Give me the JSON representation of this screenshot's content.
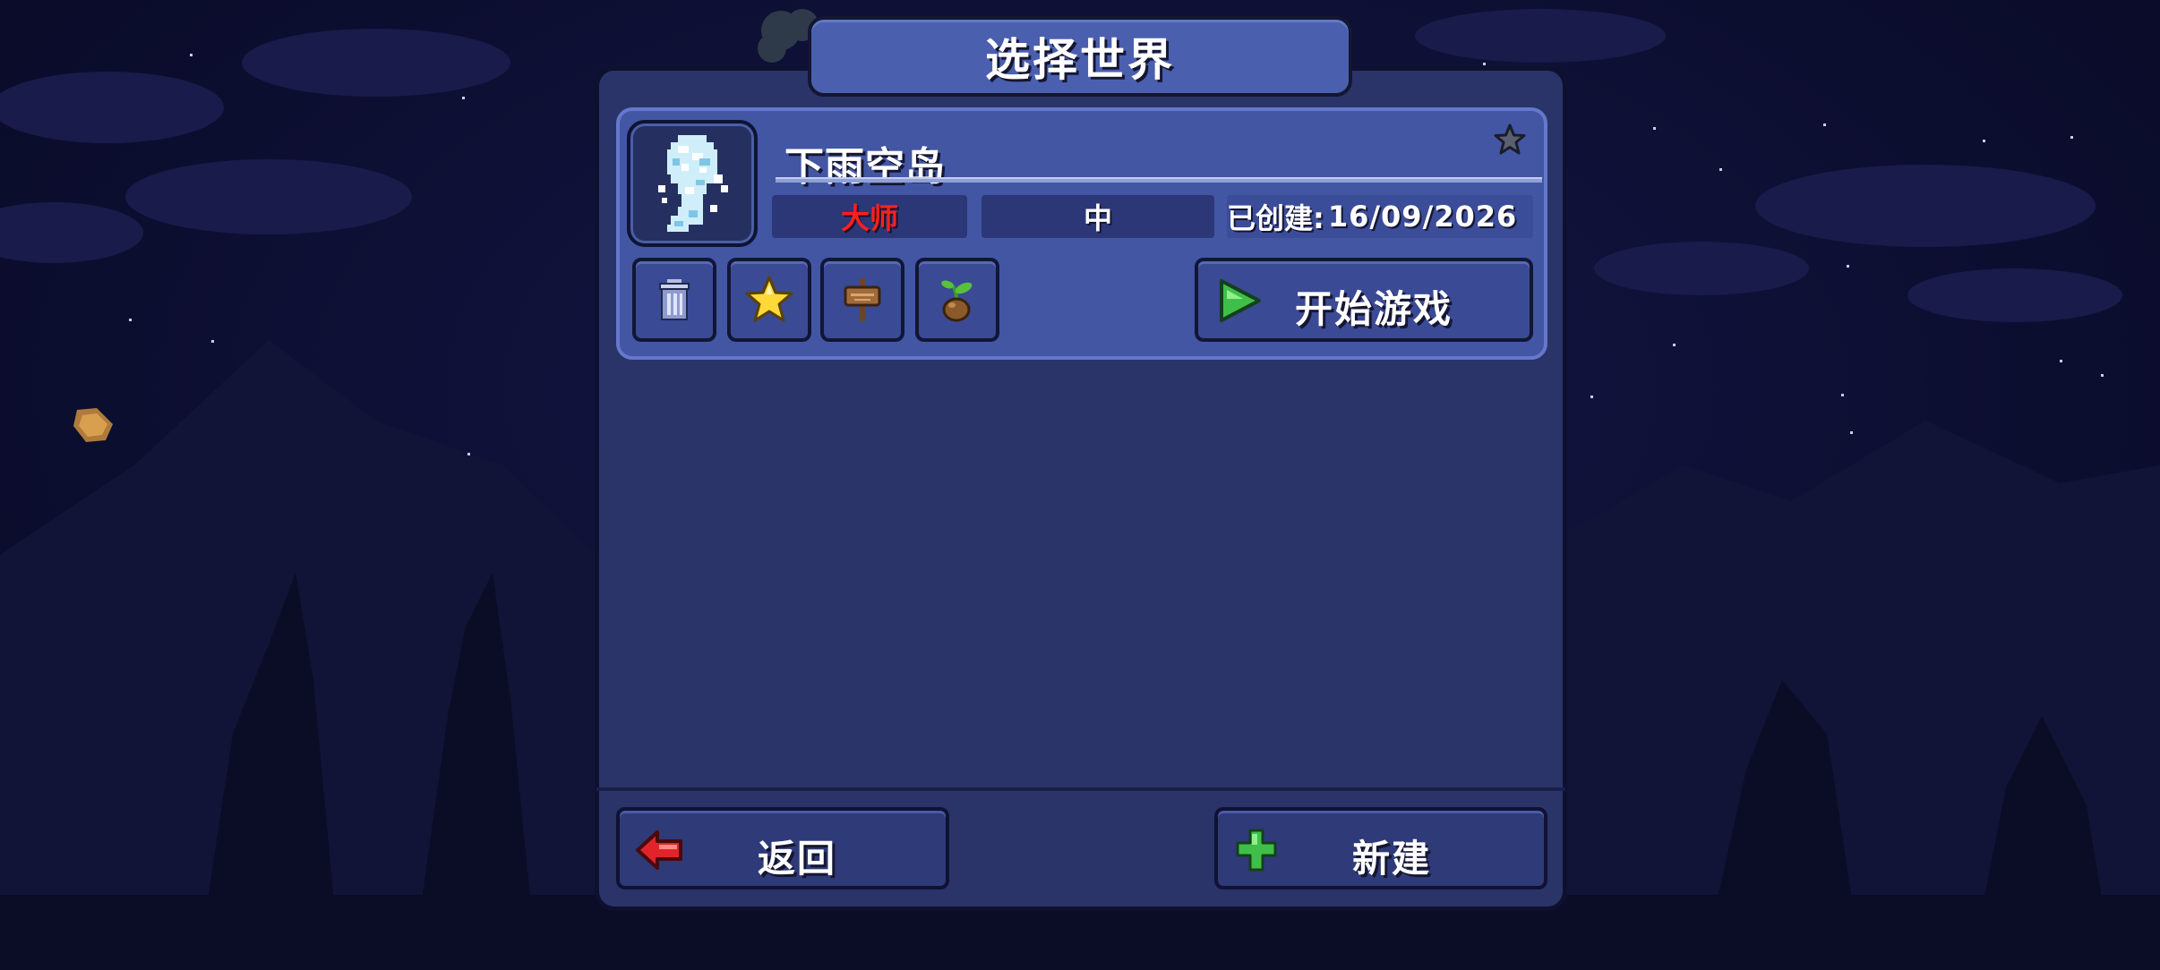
{
  "screen": {
    "title": "选择世界"
  },
  "world": {
    "name": "下雨空岛",
    "difficulty": "大师",
    "size": "中",
    "created_label": "已创建:",
    "created_date": "16/09/2026",
    "icon": "sky-island-world-icon",
    "favorite_icon": "star-outline-icon",
    "difficulty_color": "#ff1f1f"
  },
  "actions": {
    "delete_icon": "trash-can-icon",
    "favorite_icon": "gold-star-icon",
    "rename_icon": "wooden-sign-icon",
    "seed_icon": "seed-sprout-icon",
    "play_label": "开始游戏",
    "play_icon": "green-play-arrow-icon"
  },
  "footer": {
    "back_label": "返回",
    "back_icon": "red-back-arrow-icon",
    "new_label": "新建",
    "new_icon": "green-plus-icon"
  },
  "colors": {
    "panel": "#2a3468",
    "entry": "#4256a4",
    "title_bar": "#4a5fae",
    "sky": "#0e1036"
  }
}
